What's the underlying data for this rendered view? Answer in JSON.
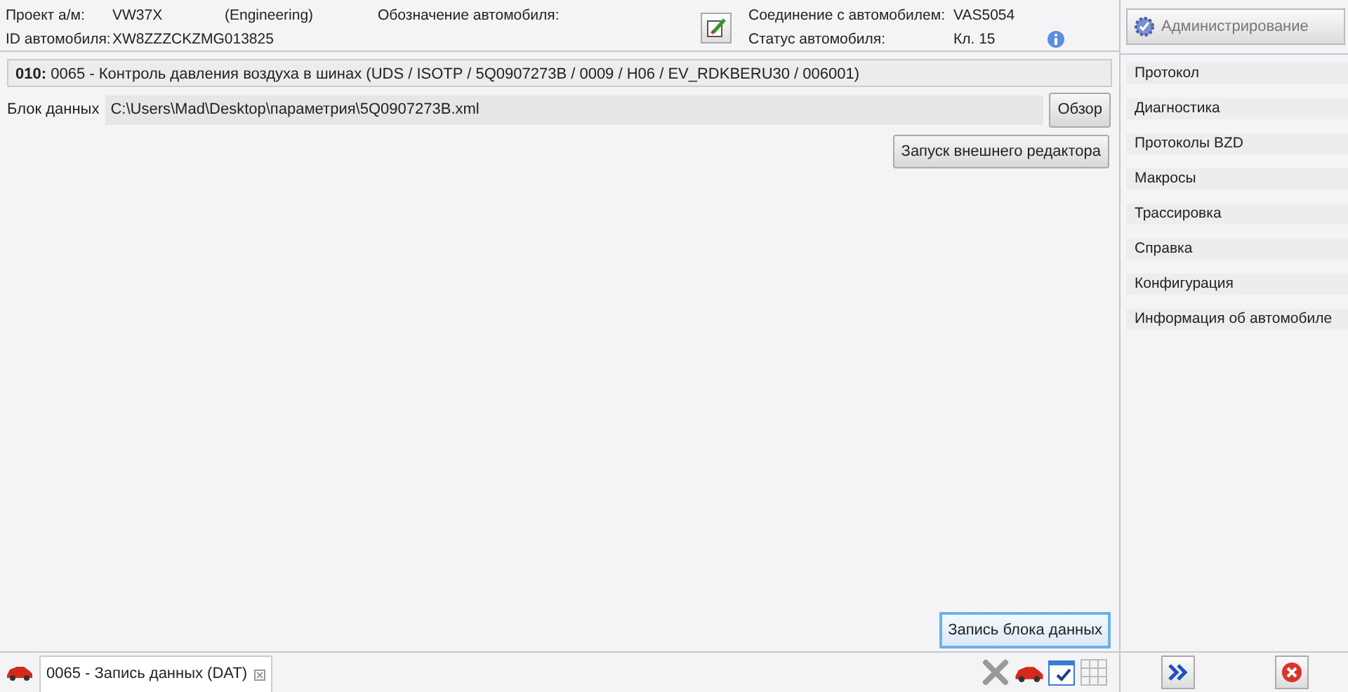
{
  "header": {
    "project_label": "Проект а/м:",
    "project_value": "VW37X",
    "project_variant": "(Engineering)",
    "designation_label": "Обозначение автомобиля:",
    "connection_label": "Соединение с автомобилем:",
    "connection_value": "VAS5054",
    "id_label": "ID автомобиля:",
    "id_value": "XW8ZZZCKZMG013825",
    "status_label": "Статус автомобиля:",
    "status_value": "Кл. 15"
  },
  "module": {
    "address": "010:",
    "title": "0065 - Контроль давления воздуха в шинах  (UDS / ISOTP / 5Q0907273B / 0009 / H06 / EV_RDKBERU30 / 006001)"
  },
  "data_block": {
    "label": "Блок данных",
    "value": "C:\\Users\\Mad\\Desktop\\параметрия\\5Q0907273B.xml",
    "browse_button": "Обзор"
  },
  "editor_button": "Запуск внешнего редактора",
  "write_button": "Запись блока данных",
  "tabs": [
    {
      "label": "0065 - Запись данных (DAT)",
      "selected": true
    }
  ],
  "sidebar": {
    "admin_button": "Администрирование",
    "items": [
      "Протокол",
      "Диагностика",
      "Протоколы BZD",
      "Макросы",
      "Трассировка",
      "Справка",
      "Конфигурация",
      "Информация об автомобиле"
    ]
  }
}
